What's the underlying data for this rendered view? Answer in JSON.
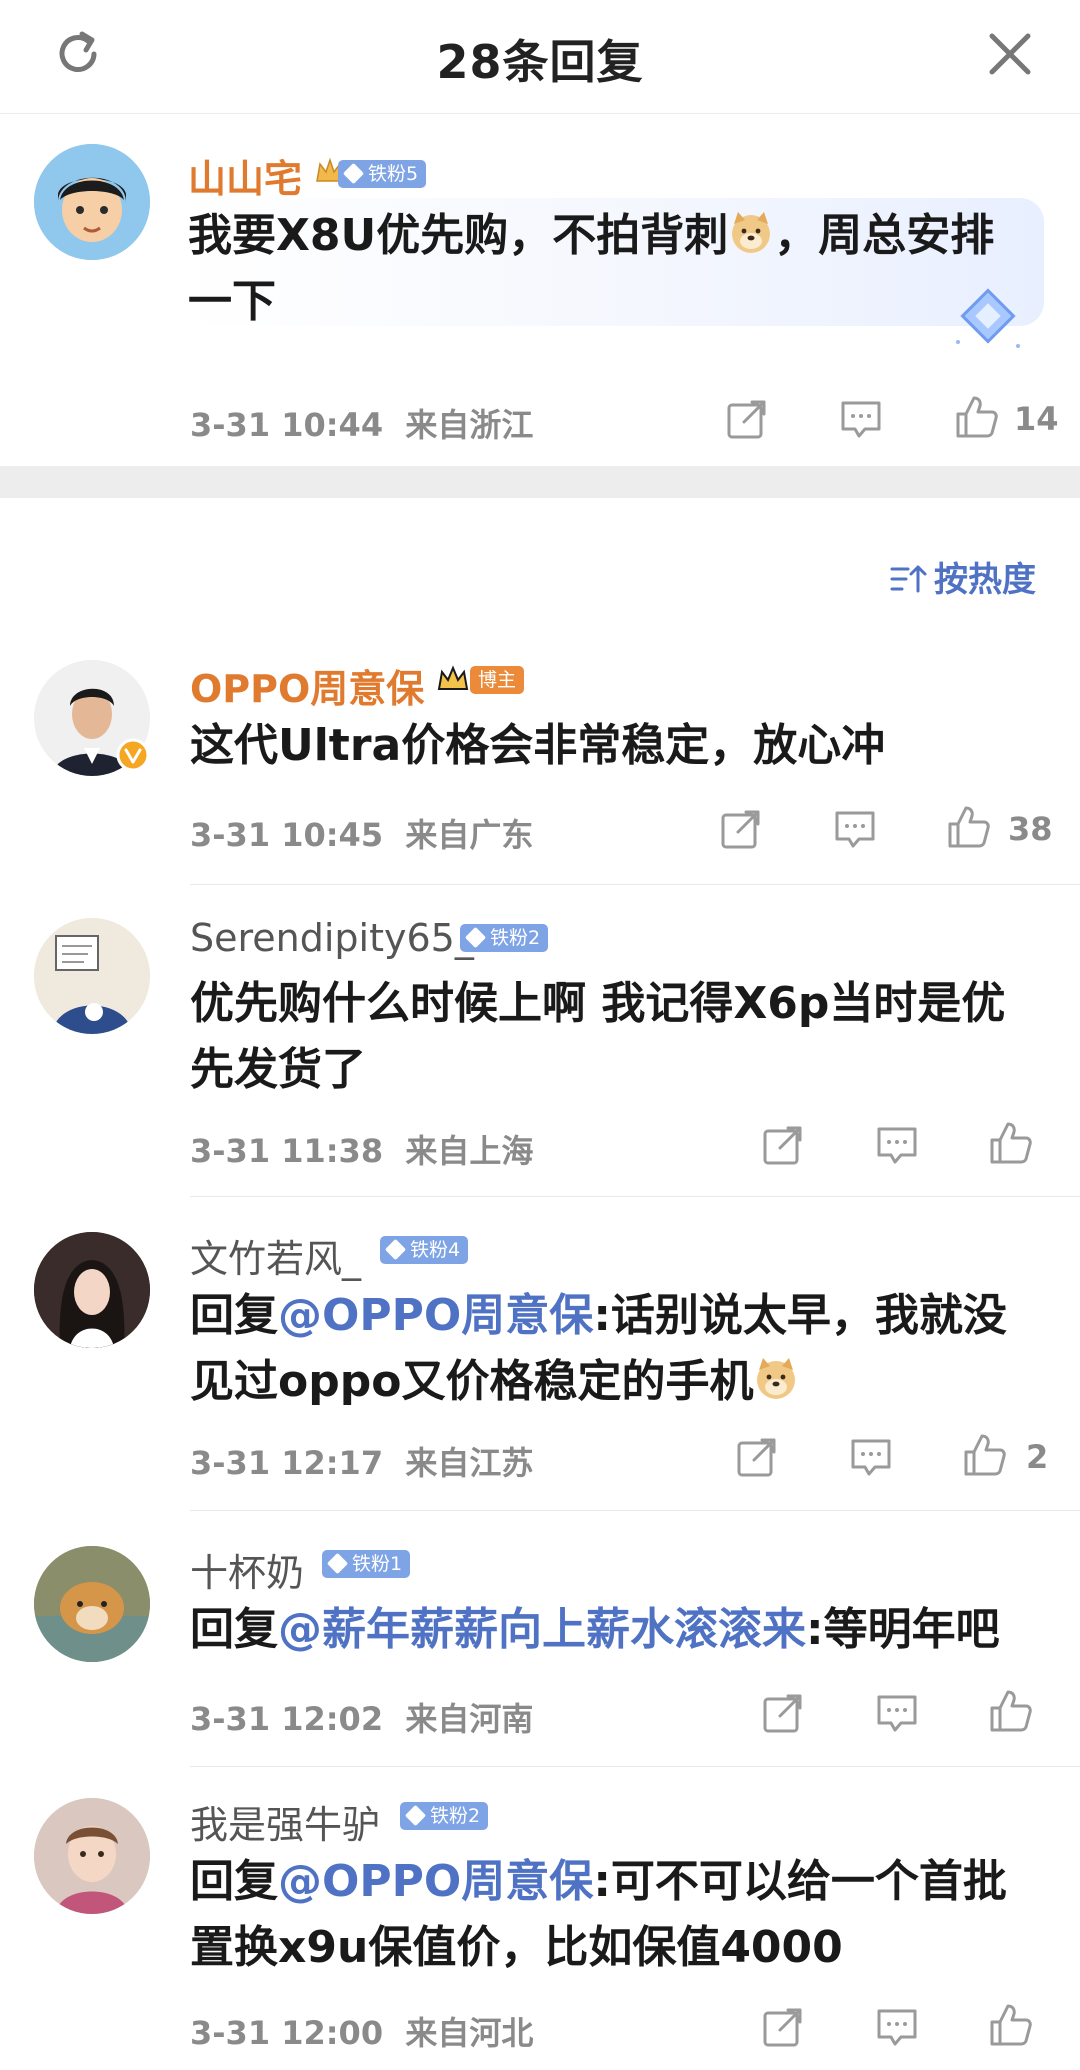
{
  "header": {
    "title": "28条回复",
    "refresh_icon": "refresh-icon",
    "close_icon": "close-icon"
  },
  "root_comment": {
    "author": "山山宅",
    "badge": "铁粉5",
    "text_line1": "我要X8U优先购，不拍背刺",
    "text_after_emoji": "，周总安排",
    "text_line2": "一下",
    "emoji": "doge-emoji",
    "time": "3-31 10:44",
    "location": "来自浙江",
    "like_count": "14"
  },
  "sort": {
    "label": "按热度",
    "icon": "sort-icon"
  },
  "comments": [
    {
      "author": "OPPO周意保",
      "badge": "博主",
      "verified": true,
      "line1": "这代Ultra价格会非常稳定，放心冲",
      "time": "3-31 10:45",
      "location": "来自广东",
      "like_count": "38"
    },
    {
      "author": "Serendipity65_",
      "badge": "铁粉2",
      "line1": "优先购什么时候上啊 我记得X6p当时是优",
      "line2": "先发货了",
      "time": "3-31 11:38",
      "location": "来自上海",
      "like_count": ""
    },
    {
      "author": "文竹若风_",
      "badge": "铁粉4",
      "reply_prefix": "回复",
      "mention": "@OPPO周意保",
      "line1_rest": ":话别说太早，我就没",
      "line2": "见过oppo又价格稳定的手机",
      "time": "3-31 12:17",
      "location": "来自江苏",
      "like_count": "2"
    },
    {
      "author": "十杯奶",
      "badge": "铁粉1",
      "reply_prefix": "回复",
      "mention": "@薪年薪薪向上薪水滚滚来",
      "line1_rest": ":等明年吧",
      "time": "3-31 12:02",
      "location": "来自河南",
      "like_count": ""
    },
    {
      "author": "我是强牛驴",
      "badge": "铁粉2",
      "reply_prefix": "回复",
      "mention": "@OPPO周意保",
      "line1_rest": ":可不可以给一个首批",
      "line2": "置换x9u保值价，比如保值4000",
      "time": "3-31 12:00",
      "location": "来自河北",
      "like_count": ""
    }
  ],
  "colors": {
    "accent": "#4f72c4",
    "author_orange": "#e07a2e",
    "meta_gray": "#8a8a8a",
    "badge_blue": "#7ea4e6"
  }
}
